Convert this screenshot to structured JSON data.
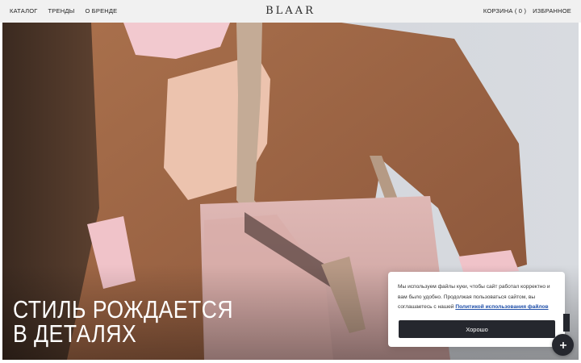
{
  "header": {
    "nav_left": [
      "КАТАЛОГ",
      "ТРЕНДЫ",
      "О БРЕНДЕ"
    ],
    "logo": "BLAAR",
    "cart_label": "КОРЗИНА ( 0 )",
    "favorites_label": "ИЗБРАННОЕ"
  },
  "hero": {
    "title_line1": "СТИЛЬ РОЖДАЕТСЯ",
    "title_line2": "В ДЕТАЛЯХ"
  },
  "cookie_notice": {
    "text": "Мы используем файлы куки, чтобы сайт работал корректно и вам было удобно. Продолжая пользоваться сайтом, вы соглашаетесь с нашей",
    "link_text": "Политикой использования файлов",
    "button_label": "Хорошо"
  },
  "fab": {
    "icon": "plus-icon"
  },
  "colors": {
    "header_bg": "#f1f1f1",
    "button_dark": "#25272e",
    "link": "#1e4ea8"
  }
}
